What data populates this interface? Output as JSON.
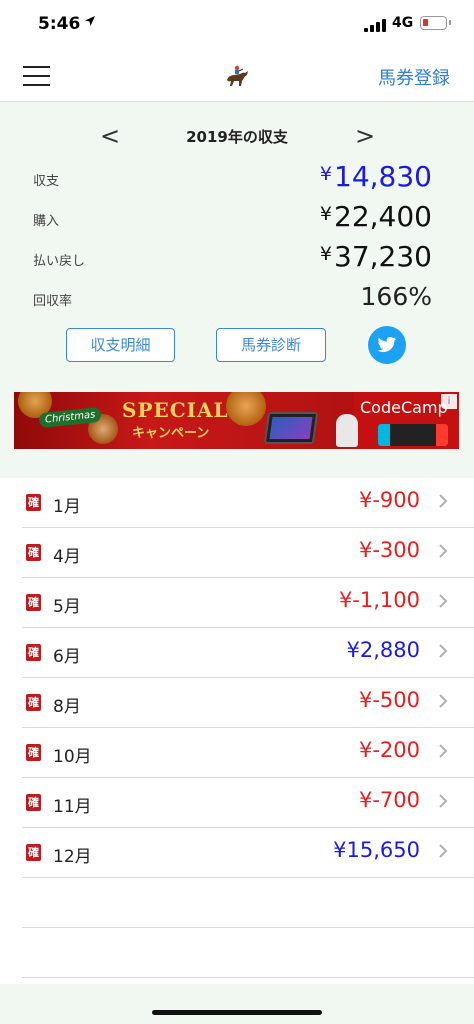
{
  "status": {
    "time": "5:46",
    "network": "4G",
    "battery_color": "#e03030"
  },
  "nav": {
    "register_label": "馬券登録",
    "menu_icon": "hamburger-menu-icon",
    "logo_icon": "jockey-horse-icon"
  },
  "summary": {
    "prev": "<",
    "next": ">",
    "title": "2019年の収支",
    "rows": [
      {
        "label": "収支",
        "currency": "¥",
        "amount": "14,830",
        "color": "blue"
      },
      {
        "label": "購入",
        "currency": "¥",
        "amount": "22,400",
        "color": "black"
      },
      {
        "label": "払い戻し",
        "currency": "¥",
        "amount": "37,230",
        "color": "black"
      },
      {
        "label": "回収率",
        "currency": "",
        "amount": "166%",
        "color": "black"
      }
    ],
    "detail_button": "収支明細",
    "diagnosis_button": "馬券診断",
    "twitter_icon": "twitter-bird-icon"
  },
  "ad": {
    "christmas": "Christmas",
    "special": "SPECIAL",
    "campaign": "キャンペーン",
    "brand": "CodeCamp",
    "choices_icon": "i"
  },
  "months": [
    {
      "badge": "確",
      "month": "1月",
      "amount": "¥-900",
      "sign": "neg"
    },
    {
      "badge": "確",
      "month": "4月",
      "amount": "¥-300",
      "sign": "neg"
    },
    {
      "badge": "確",
      "month": "5月",
      "amount": "¥-1,100",
      "sign": "neg"
    },
    {
      "badge": "確",
      "month": "6月",
      "amount": "¥2,880",
      "sign": "pos"
    },
    {
      "badge": "確",
      "month": "8月",
      "amount": "¥-500",
      "sign": "neg"
    },
    {
      "badge": "確",
      "month": "10月",
      "amount": "¥-200",
      "sign": "neg"
    },
    {
      "badge": "確",
      "month": "11月",
      "amount": "¥-700",
      "sign": "neg"
    },
    {
      "badge": "確",
      "month": "12月",
      "amount": "¥15,650",
      "sign": "pos"
    }
  ],
  "colors": {
    "negative": "#ee1c1c",
    "positive": "#1a1ae6",
    "accent": "#2f7fd6",
    "badge": "#c0191e"
  }
}
